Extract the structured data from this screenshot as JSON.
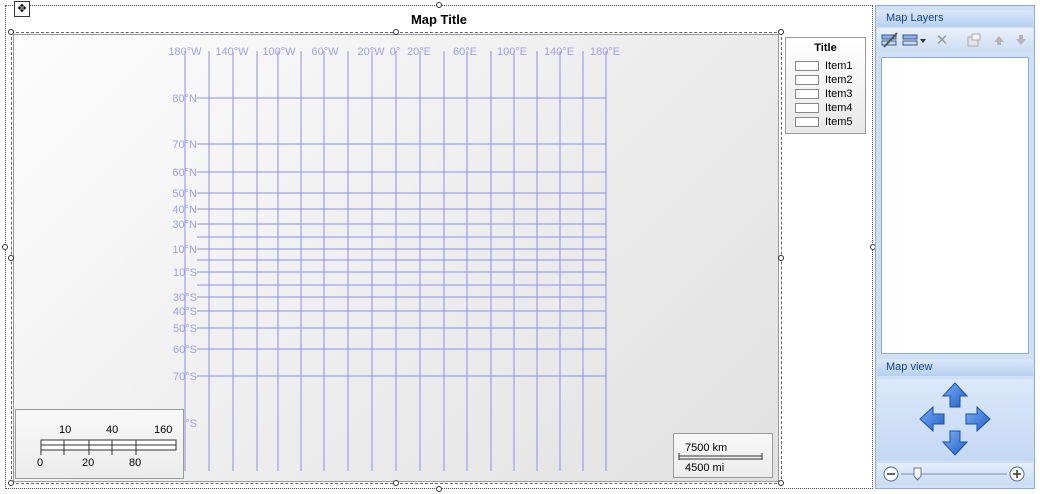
{
  "map": {
    "title": "Map Title",
    "longitude_labels": [
      "180°W",
      "140°W",
      "100°W",
      "60°W",
      "20°W",
      "0°",
      "20°E",
      "60°E",
      "100°E",
      "140°E",
      "180°E"
    ],
    "latitude_labels": [
      "80°N",
      "70°N",
      "60°N",
      "50°N",
      "40°N",
      "30°N",
      "10°N",
      "10°S",
      "30°S",
      "40°S",
      "50°S",
      "60°S",
      "70°S",
      "°S"
    ],
    "grid_color": "#8c8ff0",
    "label_color": "#9da0f0"
  },
  "legend": {
    "title": "Title",
    "items": [
      "Item1",
      "Item2",
      "Item3",
      "Item4",
      "Item5"
    ]
  },
  "scale_bar": {
    "top_labels": [
      "10",
      "40",
      "160"
    ],
    "bottom_labels": [
      "0",
      "20",
      "80"
    ]
  },
  "scale_text": {
    "km": "7500 km",
    "mi": "4500 mi"
  },
  "panel": {
    "layers_header": "Map Layers",
    "view_header": "Map view",
    "toolbar_icons": [
      "layer-properties-icon",
      "add-layer-icon",
      "remove-layer-icon",
      "layer-settings-icon",
      "move-up-icon",
      "move-down-icon"
    ],
    "accent": "#15428b",
    "arrow_color": "#2e6fd6"
  }
}
